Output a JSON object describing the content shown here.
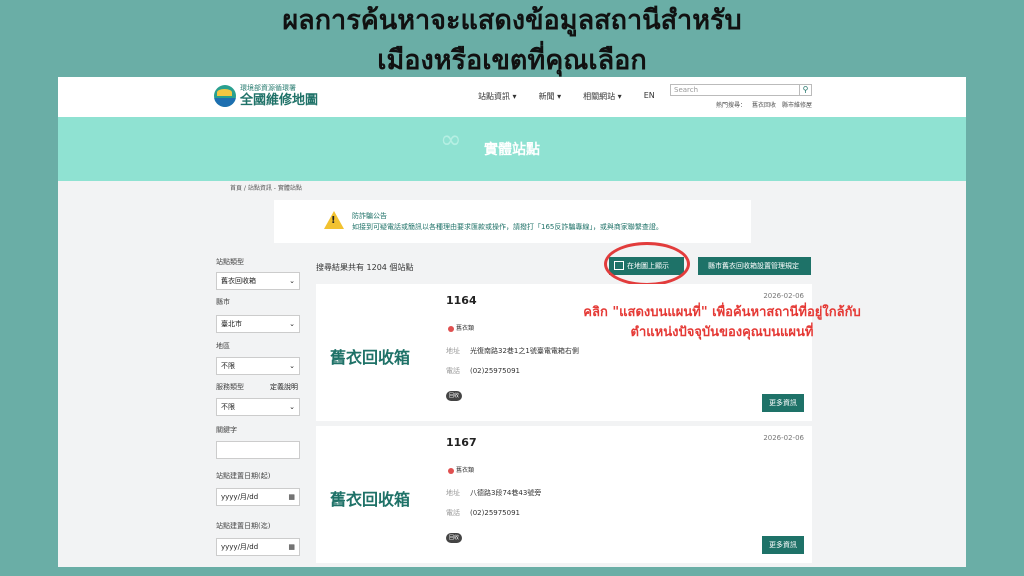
{
  "headline": {
    "line1": "ผลการค้นหาจะแสดงข้อมูลสถานีสำหรับ",
    "line2": "เมืองหรือเขตที่คุณเลือก"
  },
  "header": {
    "logo_sub": "環境部資源循環署",
    "logo_main": "全國維修地圖",
    "nav": [
      "站點資訊 ▾",
      "新聞 ▾",
      "相關網站 ▾",
      "EN"
    ],
    "search_placeholder": "Search",
    "hot_label": "熱門搜尋：",
    "hot_items": [
      "舊衣回收",
      "縣市維修屋"
    ]
  },
  "banner": {
    "title": "實體站點"
  },
  "breadcrumb": "首頁 / 站點資訊 - 實體站點",
  "notice": {
    "title": "防詐騙公告",
    "text": "如接到可疑電話或簡訊以各種理由要求匯款或操作，請撥打「165反詐騙專線」，或與商家聯繫查證。"
  },
  "filters": {
    "type_label": "站點類型",
    "type_value": "舊衣回收箱",
    "city_label": "縣市",
    "city_value": "臺北市",
    "district_label": "地區",
    "district_value": "不限",
    "service_label": "服務類型",
    "service_help": "定義說明",
    "service_value": "不限",
    "keyword_label": "關鍵字",
    "date_start_label": "站點建置日期(起)",
    "date_start_placeholder": "yyyy/月/dd",
    "date_end_label": "站點建置日期(迄)",
    "date_end_placeholder": "yyyy/月/dd"
  },
  "results": {
    "count_text": "搜尋結果共有 1204 個站點",
    "map_button": "在地圖上顯示",
    "rules_button": "縣市舊衣回收箱設置管理規定",
    "items": [
      {
        "name": "舊衣回收箱",
        "id": "1164",
        "date": "2026-02-06",
        "tag": "舊衣類",
        "addr_label": "地址",
        "address": "光復南路32巷1之1號臺電電箱右側",
        "phone_label": "電話",
        "phone": "(02)25975091",
        "badge": "回收",
        "more": "更多資訊"
      },
      {
        "name": "舊衣回收箱",
        "id": "1167",
        "date": "2026-02-06",
        "tag": "舊衣類",
        "addr_label": "地址",
        "address": "八德路3段74巷43號旁",
        "phone_label": "電話",
        "phone": "(02)25975091",
        "badge": "回收",
        "more": "更多資訊"
      }
    ]
  },
  "callout": {
    "line1": "คลิก \"แสดงบนแผนที่\" เพื่อค้นหาสถานีที่อยู่ใกล้กับ",
    "line2": "ตำแหน่งปัจจุบันของคุณบนแผนที่"
  },
  "colors": {
    "brand": "#1e7268",
    "banner": "#8fe2d2",
    "annotation": "#e53935",
    "background": "#6aaea6"
  }
}
